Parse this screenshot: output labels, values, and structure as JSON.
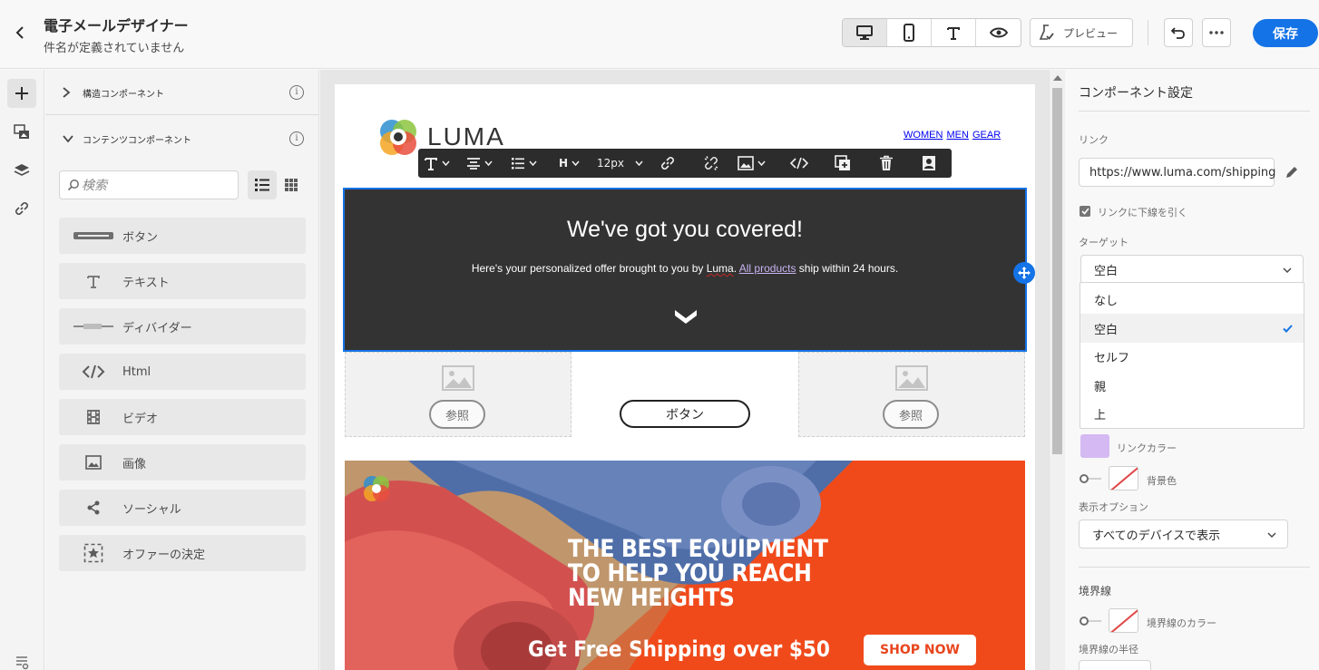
{
  "header": {
    "title": "電子メールデザイナー",
    "subtitle": "件名が定義されていません",
    "preview_label": "プレビュー",
    "save_label": "保存"
  },
  "panel": {
    "structure_section": "構造コンポーネント",
    "content_section": "コンテンツコンポーネント",
    "search_placeholder": "検索",
    "components": [
      {
        "label": "ボタン",
        "icon": "button-icon"
      },
      {
        "label": "テキスト",
        "icon": "text-icon"
      },
      {
        "label": "ディバイダー",
        "icon": "divider-icon"
      },
      {
        "label": "Html",
        "icon": "html-icon"
      },
      {
        "label": "ビデオ",
        "icon": "video-icon"
      },
      {
        "label": "画像",
        "icon": "image-icon"
      },
      {
        "label": "ソーシャル",
        "icon": "share-icon"
      },
      {
        "label": "オファーの決定",
        "icon": "offer-decision-icon"
      }
    ]
  },
  "email": {
    "logo_text": "LUMA",
    "nav": [
      "WOMEN",
      "MEN",
      "GEAR"
    ],
    "toolbar": {
      "font_size": "12px",
      "heading": "H"
    },
    "hero": {
      "title": "We've got you covered!",
      "text_before": "Here's your personalized offer brought to you by ",
      "brand": "Luma",
      "text_mid": ". ",
      "link": "All products",
      "text_after": " ship within 24 hours."
    },
    "browse_label": "参照",
    "button_label": "ボタン",
    "banner": {
      "headline_1": "THE BEST EQUIPMENT",
      "headline_2": "TO HELP YOU REACH",
      "headline_3": "NEW HEIGHTS",
      "shipping": "Get Free Shipping over $50",
      "cta": "SHOP NOW"
    }
  },
  "settings": {
    "title": "コンポーネント設定",
    "link_label": "リンク",
    "link_value": "https://www.luma.com/shipping",
    "underline_label": "リンクに下線を引く",
    "underline_checked": true,
    "target_label": "ターゲット",
    "target_value": "空白",
    "target_options": [
      "なし",
      "空白",
      "セルフ",
      "親",
      "上"
    ],
    "link_color_label": "リンクカラー",
    "link_color": "#d4b9f2",
    "bg_color_label": "背景色",
    "display_label": "表示オプション",
    "display_value": "すべてのデバイスで表示",
    "border_section": "境界線",
    "border_color_label": "境界線のカラー",
    "border_radius_label": "境界線の半径"
  },
  "colors": {
    "accent": "#1473e6",
    "hero_bg": "#333333",
    "banner_orange": "#f04a1b"
  }
}
